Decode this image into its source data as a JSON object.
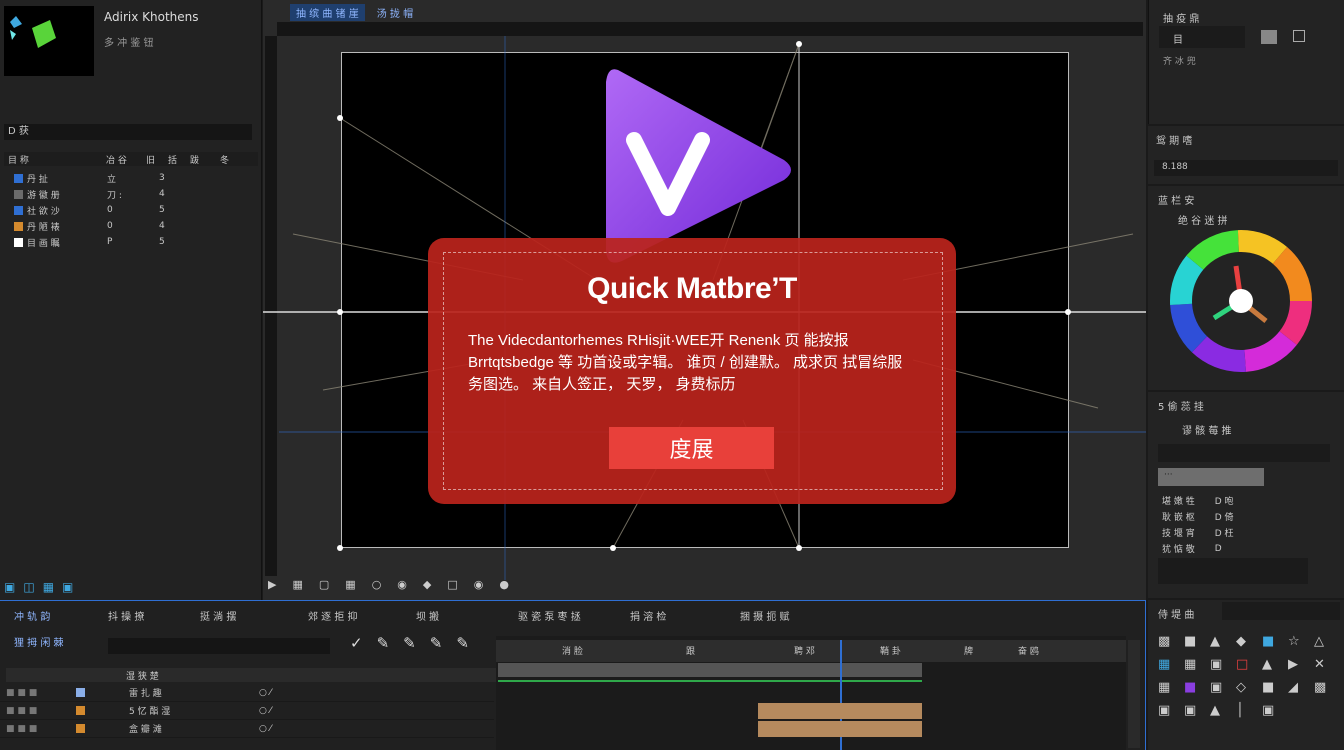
{
  "project": {
    "name": "Adirix Khothens",
    "sub": "多 冲 鉴 钮",
    "search_label": "D 获",
    "columns": [
      "目 称",
      "冶 谷",
      "旧",
      "括",
      "跋",
      "冬"
    ],
    "items": [
      {
        "name": "丹 扯",
        "c1": "立",
        "c2": "3",
        "color": "#2f6fd3"
      },
      {
        "name": "游 徽 册",
        "c1": "刀 :",
        "c2": "4",
        "color": "#6b6b6b"
      },
      {
        "name": "社 欲 沙",
        "c1": "0",
        "c2": "5",
        "color": "#2f6fd3"
      },
      {
        "name": "丹 陋 裱",
        "c1": "0",
        "c2": "4",
        "color": "#d48a2e"
      },
      {
        "name": "目 画 瞩",
        "c1": "P",
        "c2": "5",
        "color": "#ffffff"
      }
    ]
  },
  "viewer": {
    "tabs": [
      "抽 缤 曲 锗 崖",
      "汤 拢 帽"
    ],
    "dialog_title": "Quick Matbre’T",
    "dialog_body_1": "The Videcdantorhemes RHisjit·WEE开 Renenk 页 能按报",
    "dialog_body_2": "Brrtqtsbedge 等 功首设或字辑。 谁页 / 创建默。 成求页 拭冒综服",
    "dialog_body_3": "务图选。 来自人签正， 天罗， 身费标历",
    "dialog_button": "度展",
    "accent": "#8a3ee0"
  },
  "right": {
    "p1_title": "抽 疫 鼎",
    "p1_field": "目",
    "p1_small": "齐 冰 兜",
    "p2_title": "鸳 期 嗜",
    "p2_value": "8.188",
    "p3_title": "蓝 栏 安",
    "p3_sub": "绝 谷 迷 拼",
    "p4_title": "5 偷 蕊 挂",
    "p4_sub": "谬 骸 莓 推",
    "p4_field": "···",
    "p4_rows": [
      [
        "堪 嫩 牲",
        "D 咆"
      ],
      [
        "耿 嵌 枢",
        "D 倚"
      ],
      [
        "技 堰 宵",
        "D 枉"
      ],
      [
        "犹 惦 敬",
        "D"
      ]
    ],
    "p5_title": "侍 堤 曲"
  },
  "timeline": {
    "tabs": [
      "冲 轨 韵",
      "抖 操 撩",
      "挺 淌 摆",
      "郊 逐 拒 抑",
      "坝 搬",
      "驱 瓷 泵 枣 拯",
      "捐 溶 检",
      "捆 摄 扼 赋"
    ],
    "comp_label": "狸 拇 闲 棘",
    "col_label": "湿 狭 楚",
    "ruler_marks": [
      "消 脸",
      "跟",
      "聘 邓",
      "鞘 卦",
      "牌",
      "奋 鸥"
    ],
    "layers": [
      {
        "name": "雷 扎 趣",
        "color": "#8aaee8"
      },
      {
        "name": "5 忆 酯 湿",
        "color": "#d48a2e"
      },
      {
        "name": "盒 瓣 滩",
        "color": "#d48a2e"
      }
    ]
  }
}
